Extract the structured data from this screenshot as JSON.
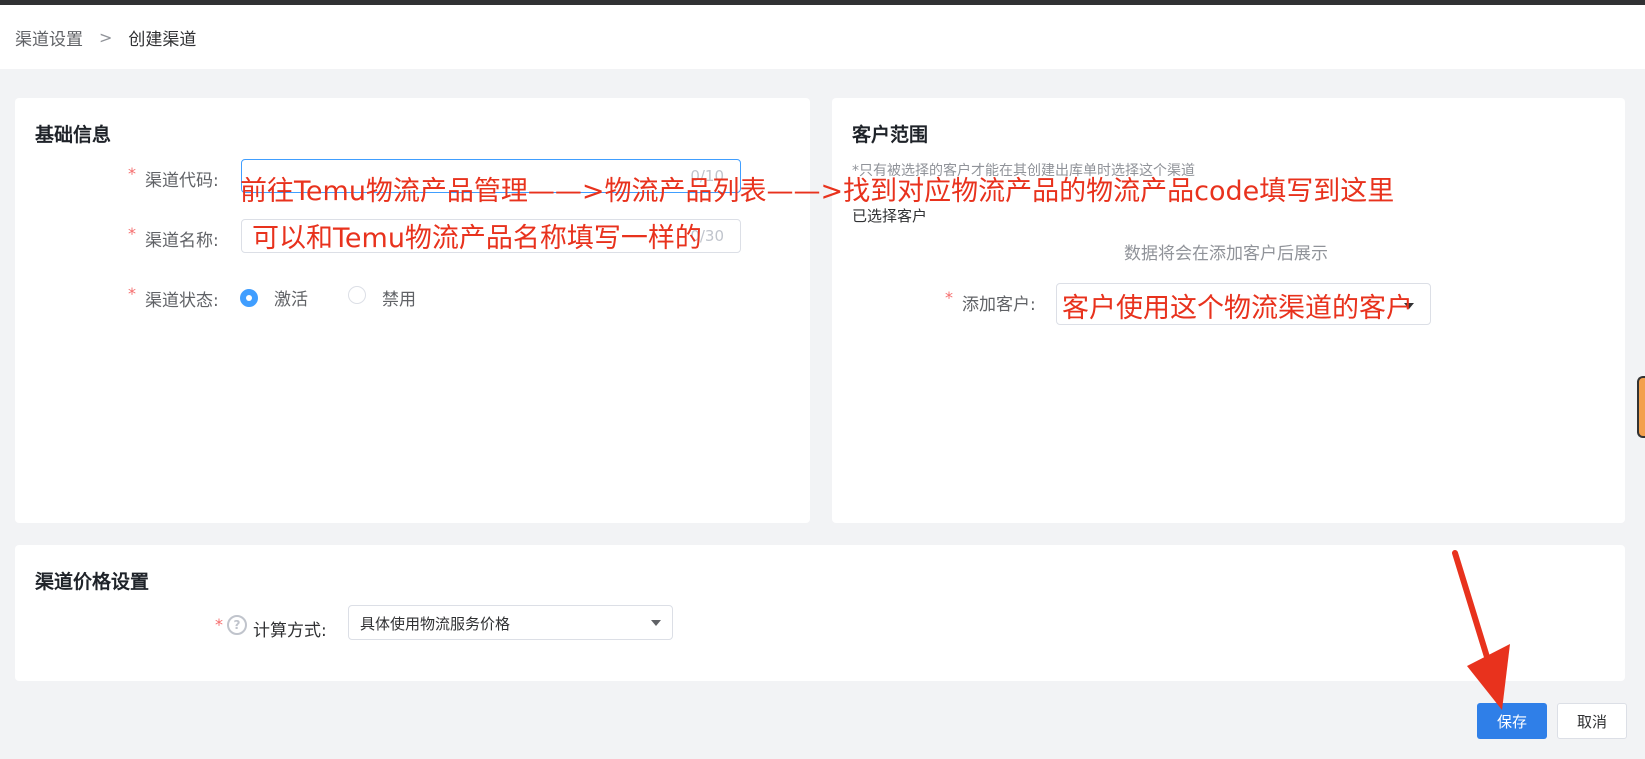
{
  "breadcrumb": {
    "parent": "渠道设置",
    "separator": ">",
    "current": "创建渠道"
  },
  "basic": {
    "title": "基础信息",
    "required_mark": "*",
    "code": {
      "label": "渠道代码:",
      "value": "",
      "counter": "0/10"
    },
    "name": {
      "label": "渠道名称:",
      "value": "",
      "counter": "0/30"
    },
    "status": {
      "label": "渠道状态:",
      "options": [
        "激活",
        "禁用"
      ],
      "selected": "激活"
    }
  },
  "customer": {
    "title": "客户范围",
    "hint": "*只有被选择的客户才能在其创建出库单时选择这个渠道",
    "selected_label": "已选择客户",
    "empty_text": "数据将会在添加客户后展示",
    "add_label": "添加客户:",
    "add_value": ""
  },
  "price": {
    "title": "渠道价格设置",
    "method_label": "计算方式:",
    "help_icon": "?",
    "method_value": "具体使用物流服务价格"
  },
  "buttons": {
    "save": "保存",
    "cancel": "取消"
  },
  "annotations": {
    "code_note": "前往Temu物流产品管理——>物流产品列表——>找到对应物流产品的物流产品code填写到这里",
    "name_note": "可以和Temu物流产品名称填写一样的",
    "customer_note": "客户使用这个物流渠道的客户",
    "color": "#e8321d"
  },
  "colors": {
    "primary": "#2f7fe8",
    "required": "#f56c6c",
    "focus_border": "#409eff"
  }
}
